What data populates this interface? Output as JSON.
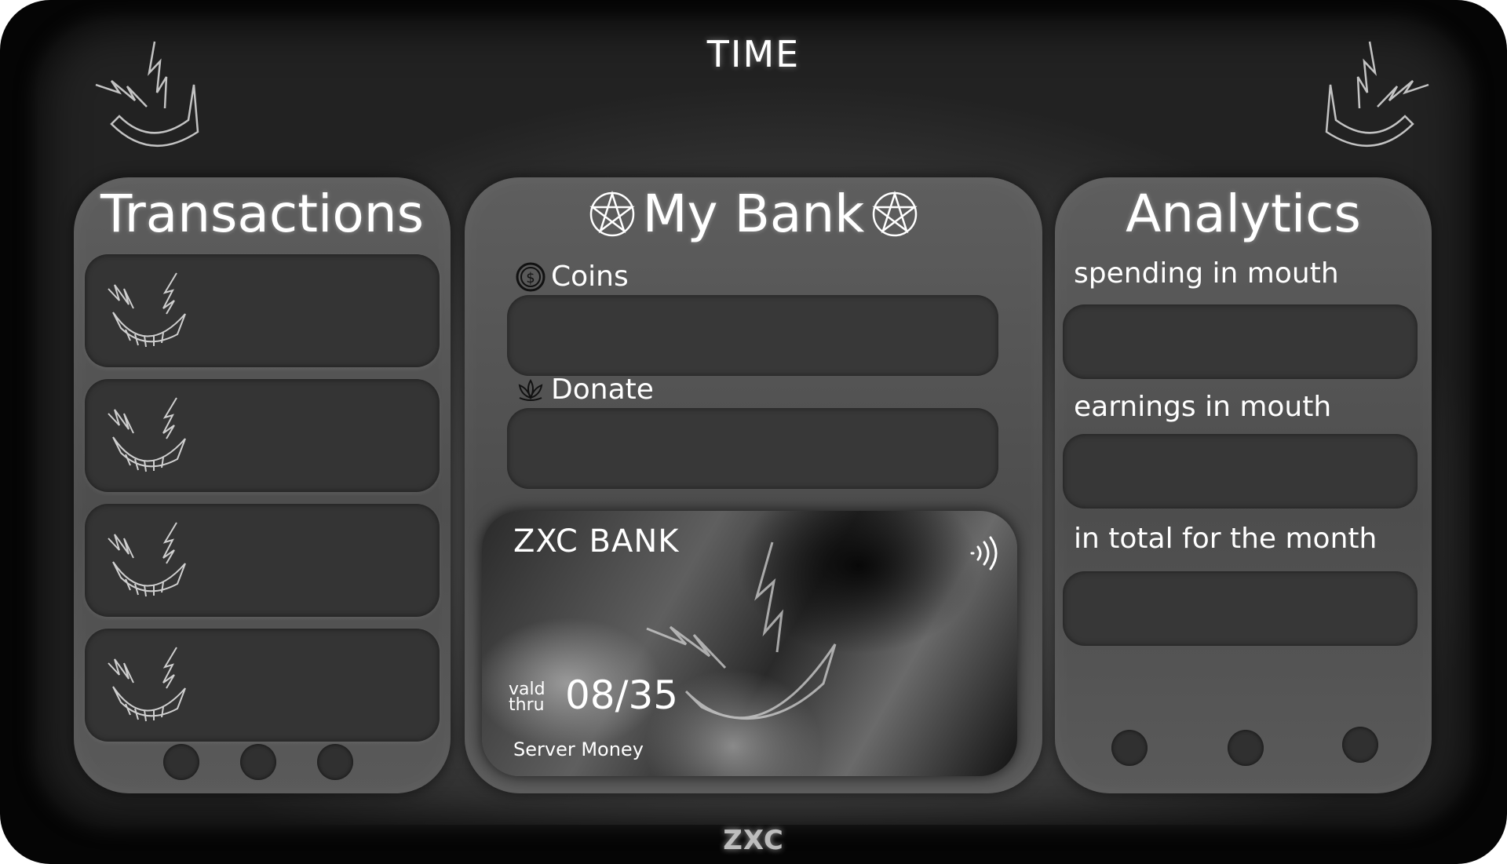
{
  "header": {
    "time_label": "TIME"
  },
  "transactions": {
    "title": "Transactions",
    "items": [
      {},
      {},
      {},
      {}
    ]
  },
  "bank": {
    "title": "My Bank",
    "coins_label": "Coins",
    "donate_label": "Donate",
    "card": {
      "brand": "ZXC BANK",
      "valid_line1": "vald",
      "valid_line2": "thru",
      "expiry": "08/35",
      "holder": "Server Money"
    }
  },
  "analytics": {
    "title": "Analytics",
    "spending_label": "spending in mouth",
    "earnings_label": "earnings in mouth",
    "total_label": "in total for the month"
  },
  "footer": {
    "logo": "ZXC"
  },
  "icons": {
    "corner": "claw-smile-icon",
    "coins": "coin-icon",
    "donate": "lotus-icon",
    "nfc": "contactless-icon",
    "title_star": "pentagram-icon"
  }
}
